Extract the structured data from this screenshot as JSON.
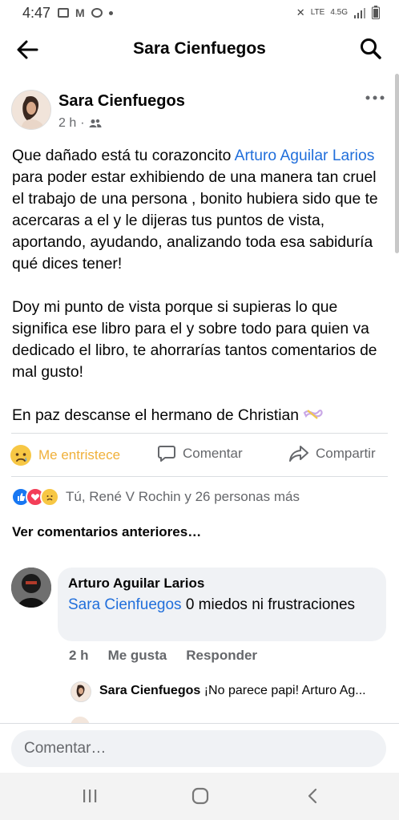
{
  "status_bar": {
    "time": "4:47",
    "network_label": "4.5G",
    "lte_label": "LTE"
  },
  "header": {
    "title": "Sara Cienfuegos"
  },
  "post": {
    "author": "Sara Cienfuegos",
    "time": "2 h",
    "paragraph1_before": "Que dañado está tu corazoncito ",
    "paragraph1_link": "Arturo Aguilar Larios",
    "paragraph1_after": "  para poder estar exhibiendo de una manera tan cruel el trabajo de una persona , bonito hubiera sido que te acercaras a el y le dijeras tus puntos de vista, aportando, ayudando, analizando toda esa sabiduría qué dices tener!",
    "paragraph2": "Doy mi punto de vista porque si supieras lo que significa ese libro para el y sobre todo para quien va dedicado el libro, te ahorrarías tantos comentarios de mal gusto!",
    "paragraph3": "En paz descanse el hermano de Christian"
  },
  "actions": {
    "react_label": "Me entristece",
    "comment_label": "Comentar",
    "share_label": "Compartir"
  },
  "reactions": {
    "summary": "Tú, René V Rochin y 26 personas más"
  },
  "comments": {
    "previous_label": "Ver comentarios anteriores…",
    "items": [
      {
        "author": "Arturo Aguilar Larios",
        "mention": "Sara Cienfuegos",
        "text": " 0 miedos ni frustraciones",
        "time": "2 h",
        "like_label": "Me gusta",
        "reply_label": "Responder"
      }
    ],
    "reply_preview": {
      "author": "Sara Cienfuegos",
      "text": "¡No parece papi! Arturo Ag..."
    }
  },
  "composer": {
    "placeholder": "Comentar…"
  },
  "colors": {
    "link": "#216fdb",
    "react_active": "#f0b03a",
    "secondary_text": "#65676b",
    "bubble": "#f0f2f5"
  }
}
